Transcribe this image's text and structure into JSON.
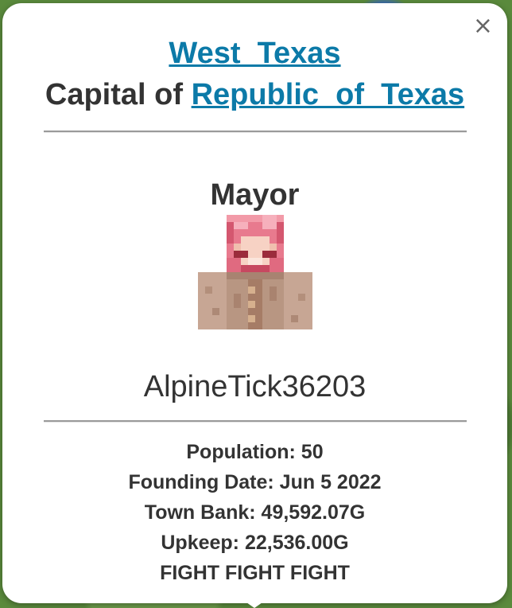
{
  "popup": {
    "close_symbol": "×",
    "town_name": "West_Texas",
    "capital_prefix": "Capital of ",
    "nation_name": "Republic_of_Texas",
    "mayor_heading": "Mayor",
    "mayor_name": "AlpineTick36203",
    "stats": {
      "population": "Population: 50",
      "founding_date": "Founding Date: Jun 5 2022",
      "town_bank": "Town Bank: 49,592.07G",
      "upkeep": "Upkeep: 22,536.00G",
      "board": "FIGHT FIGHT FIGHT"
    }
  },
  "colors": {
    "link": "#0c7aa8",
    "text": "#333333",
    "popup_background": "#ffffff"
  },
  "icons": {
    "close": "close-icon",
    "avatar": "mayor-avatar"
  }
}
